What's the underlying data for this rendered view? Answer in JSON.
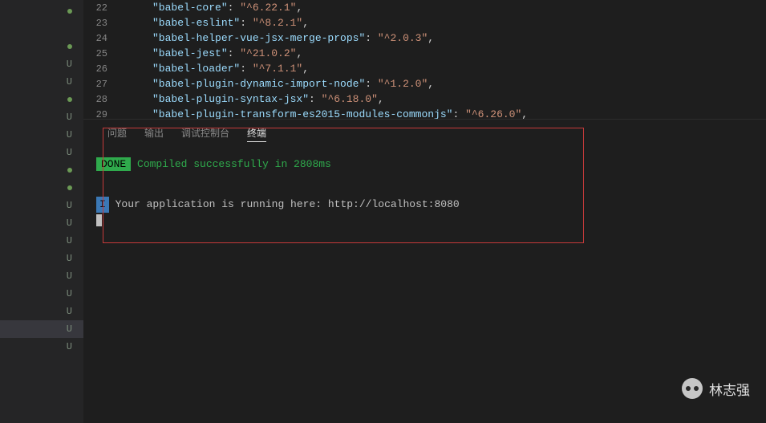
{
  "sidebar": [
    {
      "type": "dot"
    },
    {
      "type": "blank"
    },
    {
      "type": "dot"
    },
    {
      "type": "u",
      "label": "U"
    },
    {
      "type": "u",
      "label": "U"
    },
    {
      "type": "dot"
    },
    {
      "type": "u",
      "label": "U"
    },
    {
      "type": "u",
      "label": "U"
    },
    {
      "type": "u",
      "label": "U"
    },
    {
      "type": "dot"
    },
    {
      "type": "dot"
    },
    {
      "type": "u",
      "label": "U"
    },
    {
      "type": "u",
      "label": "U"
    },
    {
      "type": "u",
      "label": "U"
    },
    {
      "type": "u",
      "label": "U"
    },
    {
      "type": "u",
      "label": "U"
    },
    {
      "type": "u",
      "label": "U"
    },
    {
      "type": "u",
      "label": "U"
    },
    {
      "type": "u",
      "label": "U",
      "highlight": true
    },
    {
      "type": "u",
      "label": "U"
    }
  ],
  "code": [
    {
      "n": "22",
      "key": "babel-core",
      "val": "^6.22.1"
    },
    {
      "n": "23",
      "key": "babel-eslint",
      "val": "^8.2.1"
    },
    {
      "n": "24",
      "key": "babel-helper-vue-jsx-merge-props",
      "val": "^2.0.3"
    },
    {
      "n": "25",
      "key": "babel-jest",
      "val": "^21.0.2"
    },
    {
      "n": "26",
      "key": "babel-loader",
      "val": "^7.1.1"
    },
    {
      "n": "27",
      "key": "babel-plugin-dynamic-import-node",
      "val": "^1.2.0"
    },
    {
      "n": "28",
      "key": "babel-plugin-syntax-jsx",
      "val": "^6.18.0"
    },
    {
      "n": "29",
      "key": "babel-plugin-transform-es2015-modules-commonjs",
      "val": "^6.26.0"
    }
  ],
  "tabs": {
    "problems": "问题",
    "output": "输出",
    "debug": "调试控制台",
    "terminal": "终端"
  },
  "terminal": {
    "done_badge": "DONE",
    "done_msg": " Compiled successfully in 2808ms",
    "i_badge": "I",
    "app_msg": "  Your application is running here: http://localhost:8080"
  },
  "watermark": {
    "name": "林志强"
  }
}
